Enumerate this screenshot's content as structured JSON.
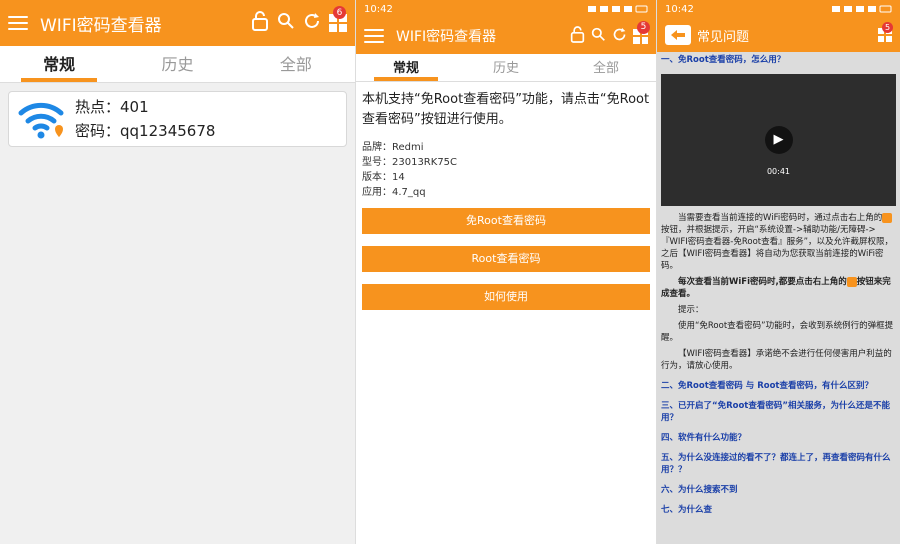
{
  "panel1": {
    "title": "WIFI密码查看器",
    "badge": "6",
    "tabs": [
      "常规",
      "历史",
      "全部"
    ],
    "wifi": {
      "ssid_label": "热点：",
      "ssid": "401",
      "pwd_label": "密码：",
      "pwd": "qq12345678"
    }
  },
  "panel2": {
    "status_time": "10:42",
    "title": "WIFI密码查看器",
    "badge": "5",
    "tabs": [
      "常规",
      "历史",
      "全部"
    ],
    "intro": "本机支持“免Root查看密码”功能，请点击“免Root查看密码”按钮进行使用。",
    "info": [
      {
        "label": "品牌：",
        "value": "Redmi"
      },
      {
        "label": "型号：",
        "value": "23013RK75C"
      },
      {
        "label": "版本：",
        "value": "14"
      },
      {
        "label": "应用：",
        "value": "4.7_qq"
      }
    ],
    "buttons": [
      "免Root查看密码",
      "Root查看密码",
      "如何使用"
    ]
  },
  "panel3": {
    "status_time": "10:42",
    "title": "常见问题",
    "badge": "5",
    "q1": "一、免Root查看密码，怎么用？",
    "video_time": "00:41",
    "para1a": "当需要查看当前连接的WiFi密码时，通过点击右上角的",
    "para1b": "按钮，并根据提示，开启“系统设置->辅助功能/无障碍->『WIFI密码查看器-免Root查看』服务”，以及允许截屏权限，之后【WIFI密码查看器】将自动为您获取当前连接的WiFi密码。",
    "para2a": "每次查看当前WiFi密码时,都要点击右上角的",
    "para2b": "按钮来完成查看。",
    "tip_title": "提示：",
    "tip1": "使用“免Root查看密码”功能时，会收到系统例行的弹框提醒。",
    "tip2": "【WIFI密码查看器】承诺绝不会进行任何侵害用户利益的行为，请放心使用。",
    "questions": [
      "二、免Root查看密码 与 Root查看密码，有什么区别？",
      "三、已开启了“免Root查看密码”相关服务，为什么还是不能用？",
      "四、软件有什么功能？",
      "五、为什么没连接过的看不了？都连上了，再查看密码有什么用？？",
      "六、为什么搜索不到",
      "七、为什么查"
    ]
  },
  "colors": {
    "accent": "#f7931e",
    "link": "#1a3fa8",
    "wifi_icon": "#1e88e5"
  }
}
